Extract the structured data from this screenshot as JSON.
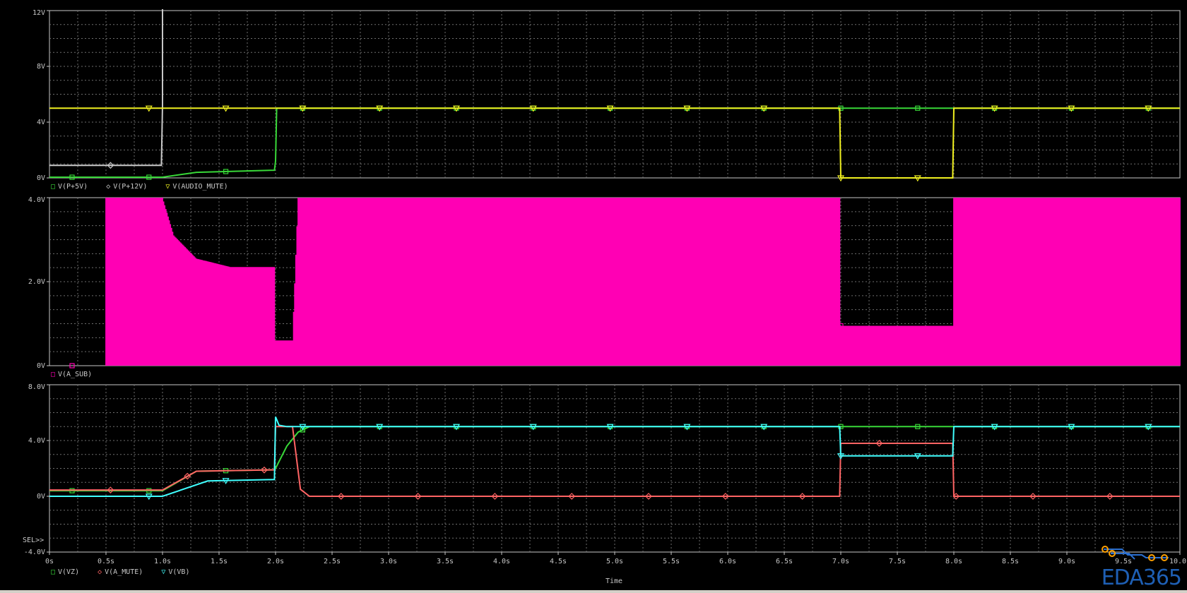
{
  "chart_data": {
    "type": "line",
    "x_unit": "s",
    "xlim": [
      0,
      10
    ],
    "x_ticks": [
      "0s",
      "0.5s",
      "1.0s",
      "1.5s",
      "2.0s",
      "2.5s",
      "3.0s",
      "3.5s",
      "4.0s",
      "4.5s",
      "5.0s",
      "5.5s",
      "6.0s",
      "6.5s",
      "7.0s",
      "7.5s",
      "8.0s",
      "8.5s",
      "9.0s",
      "9.5s",
      "10.0s"
    ],
    "xlabel": "Time",
    "grid": true,
    "background": "#000000",
    "panels": [
      {
        "ylim": [
          0,
          12
        ],
        "y_ticks": [
          "0V",
          "4V",
          "8V",
          "12V"
        ],
        "y_tick_values": [
          0,
          4,
          8,
          12
        ],
        "series": [
          {
            "name": "V(P+5V)",
            "color": "#38d838",
            "marker": "square",
            "x": [
              0,
              1.0,
              1.3,
              1.99,
              2.0,
              2.01,
              10
            ],
            "y": [
              0.05,
              0.05,
              0.4,
              0.55,
              1.2,
              5.0,
              5.0
            ]
          },
          {
            "name": "V(P+12V)",
            "color": "#c8c8c8",
            "marker": "diamond",
            "x": [
              0,
              0.99,
              1.0,
              1.0
            ],
            "y": [
              0.9,
              0.9,
              5.2,
              12.1
            ]
          },
          {
            "name": "V(AUDIO_MUTE)",
            "color": "#f0f020",
            "marker": "triangle",
            "x": [
              0,
              6.99,
              7.0,
              7.99,
              8.0,
              10
            ],
            "y": [
              5.0,
              5.0,
              0,
              0,
              5.0,
              5.0
            ]
          }
        ]
      },
      {
        "ylim": [
          0,
          4
        ],
        "y_ticks": [
          "0V",
          "2.0V",
          "4.0V"
        ],
        "y_tick_values": [
          0,
          2,
          4
        ],
        "series": [
          {
            "name": "V(A_SUB)",
            "color": "#ff00b4",
            "marker": "square",
            "style": "oscillating band between 0V and envelope",
            "x": [
              0,
              0.49,
              0.5,
              1.0,
              1.1,
              1.3,
              1.6,
              1.99,
              2.0,
              2.15,
              2.2,
              6.99,
              7.0,
              7.99,
              8.0,
              10
            ],
            "y": [
              0,
              0,
              4.0,
              4.0,
              3.1,
              2.55,
              2.35,
              2.35,
              0.6,
              0.6,
              4.0,
              4.0,
              0.95,
              0.95,
              4.0,
              4.0
            ]
          }
        ]
      },
      {
        "ylim": [
          -4,
          8
        ],
        "y_ticks": [
          "-4.0V",
          "0V",
          "4.0V",
          "8.0V"
        ],
        "y_tick_values": [
          -4,
          0,
          4,
          8
        ],
        "series": [
          {
            "name": "V(VZ)",
            "color": "#38d838",
            "marker": "square",
            "x": [
              0,
              1.0,
              1.3,
              1.99,
              2.0,
              2.1,
              2.2,
              2.3,
              10
            ],
            "y": [
              0.4,
              0.4,
              1.8,
              1.9,
              2.0,
              3.6,
              4.6,
              5.0,
              5.0
            ]
          },
          {
            "name": "V(A_MUTE)",
            "color": "#ff6464",
            "marker": "diamond",
            "x": [
              0,
              1.0,
              1.3,
              1.99,
              2.0,
              2.15,
              2.22,
              2.3,
              6.99,
              7.0,
              7.99,
              8.0,
              10
            ],
            "y": [
              0.45,
              0.45,
              1.8,
              1.9,
              5.0,
              5.0,
              0.5,
              0.0,
              0.0,
              3.8,
              3.8,
              0.0,
              0.0
            ]
          },
          {
            "name": "V(VB)",
            "color": "#40ffff",
            "marker": "triangle",
            "x": [
              0,
              1.0,
              1.4,
              1.99,
              2.0,
              2.03,
              2.1,
              6.99,
              7.0,
              7.99,
              8.0,
              10
            ],
            "y": [
              0,
              0,
              1.1,
              1.2,
              5.7,
              5.1,
              5.0,
              5.0,
              2.9,
              2.9,
              5.0,
              5.0
            ]
          }
        ]
      }
    ]
  },
  "labels": {
    "legend_top": [
      "V(P+5V)",
      "V(P+12V)",
      "V(AUDIO_MUTE)"
    ],
    "legend_mid": [
      "V(A_SUB)"
    ],
    "legend_bottom": [
      "V(VZ)",
      "V(A_MUTE)",
      "V(VB)"
    ],
    "sel": "SEL>>",
    "brand": "EDA365"
  }
}
